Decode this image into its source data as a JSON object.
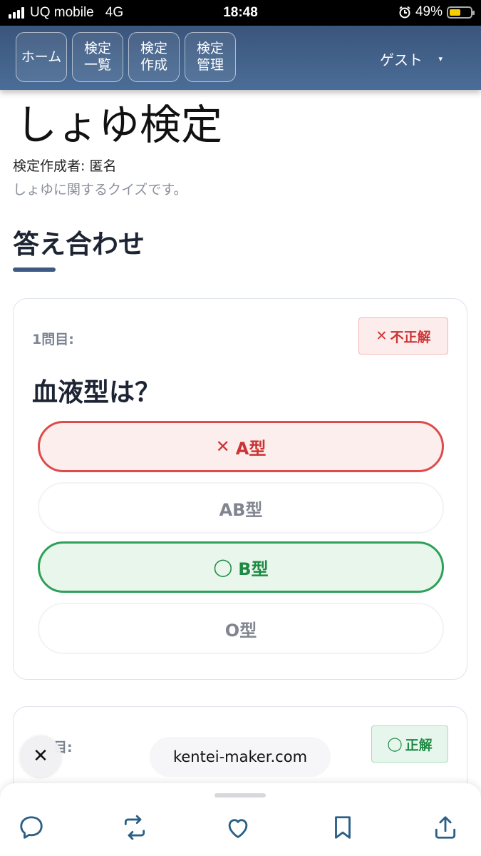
{
  "status_bar": {
    "carrier": "UQ mobile",
    "network": "4G",
    "time": "18:48",
    "battery_percent": "49%",
    "battery_level": 0.49,
    "icons": [
      "signal-icon",
      "alarm-icon",
      "battery-icon"
    ]
  },
  "nav": {
    "buttons": [
      {
        "label": "ホーム"
      },
      {
        "label": "検定\n一覧"
      },
      {
        "label": "検定\n作成"
      },
      {
        "label": "検定\n管理"
      }
    ],
    "user_label": "ゲスト",
    "user_caret": "▾"
  },
  "page": {
    "title": "しょゆ検定",
    "author": "検定作成者: 匿名",
    "description": "しょゆに関するクイズです。",
    "section_title": "答え合わせ"
  },
  "questions": [
    {
      "number": "1問目:",
      "result": "不正解",
      "result_icon": "✕",
      "text": "血液型は？",
      "options": [
        {
          "label": "A型",
          "state": "selected-wrong",
          "icon": "✕"
        },
        {
          "label": "AB型",
          "state": "neutral"
        },
        {
          "label": "B型",
          "state": "correct",
          "icon": "◯"
        },
        {
          "label": "O型",
          "state": "neutral"
        }
      ]
    },
    {
      "number": "目:",
      "result": "正解",
      "result_icon": "◯"
    }
  ],
  "overlay": {
    "close_label": "✕",
    "url": "kentei-maker.com"
  },
  "bottom_bar": {
    "icons": [
      "reply-icon",
      "retweet-icon",
      "like-icon",
      "bookmark-icon",
      "share-icon"
    ]
  },
  "colors": {
    "nav_bg": "#3f5a82",
    "wrong": "#cc3333",
    "correct": "#1e8a44",
    "accent": "#3f5a82"
  }
}
